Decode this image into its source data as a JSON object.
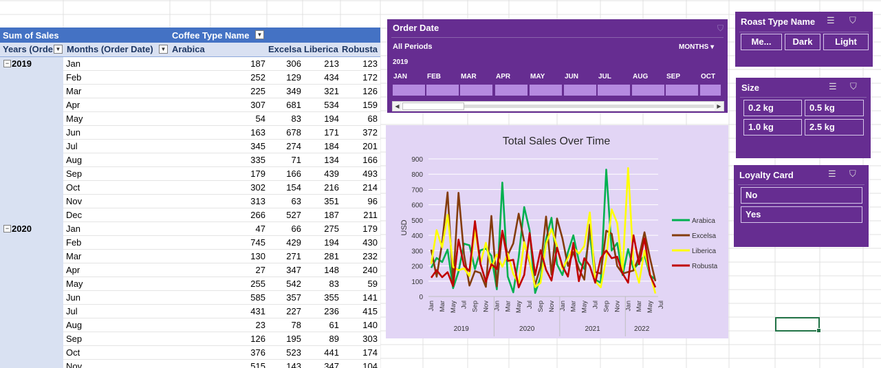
{
  "pivot": {
    "header": {
      "sum_label": "Sum of Sales",
      "col_field": "Coffee Type Name",
      "years_field": "Years (Orde",
      "months_field": "Months (Order Date)"
    },
    "columns": [
      "Arabica",
      "Excelsa",
      "Liberica",
      "Robusta"
    ],
    "rows": [
      {
        "year": "2019",
        "month": "Jan",
        "v": [
          187,
          306,
          213,
          123
        ]
      },
      {
        "year": "",
        "month": "Feb",
        "v": [
          252,
          129,
          434,
          172
        ]
      },
      {
        "year": "",
        "month": "Mar",
        "v": [
          225,
          349,
          321,
          126
        ]
      },
      {
        "year": "",
        "month": "Apr",
        "v": [
          307,
          681,
          534,
          159
        ]
      },
      {
        "year": "",
        "month": "May",
        "v": [
          54,
          83,
          194,
          68
        ]
      },
      {
        "year": "",
        "month": "Jun",
        "v": [
          163,
          678,
          171,
          372
        ]
      },
      {
        "year": "",
        "month": "Jul",
        "v": [
          345,
          274,
          184,
          201
        ]
      },
      {
        "year": "",
        "month": "Aug",
        "v": [
          335,
          71,
          134,
          166
        ]
      },
      {
        "year": "",
        "month": "Sep",
        "v": [
          179,
          166,
          439,
          493
        ]
      },
      {
        "year": "",
        "month": "Oct",
        "v": [
          302,
          154,
          216,
          214
        ]
      },
      {
        "year": "",
        "month": "Nov",
        "v": [
          313,
          63,
          351,
          96
        ]
      },
      {
        "year": "",
        "month": "Dec",
        "v": [
          266,
          527,
          187,
          211
        ]
      },
      {
        "year": "2020",
        "month": "Jan",
        "v": [
          47,
          66,
          275,
          179
        ]
      },
      {
        "year": "",
        "month": "Feb",
        "v": [
          745,
          429,
          194,
          430
        ]
      },
      {
        "year": "",
        "month": "Mar",
        "v": [
          130,
          271,
          281,
          232
        ]
      },
      {
        "year": "",
        "month": "Apr",
        "v": [
          27,
          347,
          148,
          240
        ]
      },
      {
        "year": "",
        "month": "May",
        "v": [
          255,
          542,
          83,
          59
        ]
      },
      {
        "year": "",
        "month": "Jun",
        "v": [
          585,
          357,
          355,
          141
        ]
      },
      {
        "year": "",
        "month": "Jul",
        "v": [
          431,
          227,
          236,
          415
        ]
      },
      {
        "year": "",
        "month": "Aug",
        "v": [
          23,
          78,
          61,
          140
        ]
      },
      {
        "year": "",
        "month": "Sep",
        "v": [
          126,
          195,
          89,
          303
        ]
      },
      {
        "year": "",
        "month": "Oct",
        "v": [
          376,
          523,
          441,
          174
        ]
      },
      {
        "year": "",
        "month": "Nov",
        "v": [
          515,
          143,
          347,
          104
        ]
      }
    ]
  },
  "timeline": {
    "title": "Order Date",
    "all_periods": "All Periods",
    "level": "MONTHS",
    "year": "2019",
    "months": [
      "JAN",
      "FEB",
      "MAR",
      "APR",
      "MAY",
      "JUN",
      "JUL",
      "AUG",
      "SEP",
      "OCT"
    ]
  },
  "slicers": {
    "roast": {
      "title": "Roast Type Name",
      "items": [
        "Me...",
        "Dark",
        "Light"
      ]
    },
    "size": {
      "title": "Size",
      "items": [
        "0.2 kg",
        "0.5 kg",
        "1.0 kg",
        "2.5 kg"
      ]
    },
    "loyalty": {
      "title": "Loyalty Card",
      "items": [
        "No",
        "Yes"
      ]
    }
  },
  "chart_data": {
    "type": "line",
    "title": "Total Sales Over Time",
    "ylabel": "USD",
    "ylim": [
      0,
      900
    ],
    "yticks": [
      0,
      100,
      200,
      300,
      400,
      500,
      600,
      700,
      800,
      900
    ],
    "grid": true,
    "legend_position": "right",
    "month_labels": [
      "Jan",
      "Mar",
      "May",
      "Jul",
      "Sep",
      "Nov",
      "Jan",
      "Mar",
      "May",
      "Jul",
      "Sep",
      "Nov",
      "Jan",
      "Mar",
      "May",
      "Jul",
      "Sep",
      "Nov",
      "Jan",
      "Mar",
      "May",
      "Jul"
    ],
    "years": [
      "2019",
      "2020",
      "2021",
      "2022"
    ],
    "series": [
      {
        "name": "Arabica",
        "color": "#00b050",
        "values": [
          187,
          252,
          225,
          307,
          54,
          163,
          345,
          335,
          179,
          302,
          313,
          266,
          47,
          745,
          130,
          27,
          255,
          585,
          431,
          23,
          126,
          376,
          515,
          210,
          140,
          290,
          400,
          230,
          180,
          420,
          110,
          90,
          830,
          300,
          350,
          140,
          310,
          180,
          220,
          270,
          140,
          110
        ]
      },
      {
        "name": "Excelsa",
        "color": "#843c0c",
        "values": [
          306,
          129,
          349,
          681,
          83,
          678,
          274,
          71,
          166,
          154,
          63,
          527,
          66,
          429,
          271,
          347,
          542,
          357,
          227,
          78,
          195,
          523,
          143,
          510,
          380,
          200,
          290,
          180,
          110,
          470,
          160,
          150,
          430,
          410,
          200,
          150,
          160,
          170,
          260,
          420,
          250,
          100
        ]
      },
      {
        "name": "Liberica",
        "color": "#ffff00",
        "values": [
          213,
          434,
          321,
          534,
          194,
          171,
          184,
          134,
          439,
          216,
          351,
          187,
          275,
          194,
          281,
          148,
          83,
          355,
          236,
          61,
          89,
          347,
          441,
          330,
          180,
          250,
          320,
          280,
          330,
          550,
          100,
          60,
          250,
          570,
          480,
          170,
          840,
          210,
          90,
          300,
          150,
          20
        ]
      },
      {
        "name": "Robusta",
        "color": "#c00000",
        "values": [
          123,
          172,
          126,
          159,
          68,
          372,
          201,
          166,
          493,
          214,
          96,
          211,
          179,
          430,
          232,
          240,
          59,
          141,
          415,
          140,
          303,
          174,
          104,
          320,
          200,
          130,
          350,
          100,
          250,
          200,
          90,
          250,
          300,
          250,
          260,
          150,
          90,
          400,
          210,
          380,
          140,
          60
        ]
      }
    ]
  }
}
